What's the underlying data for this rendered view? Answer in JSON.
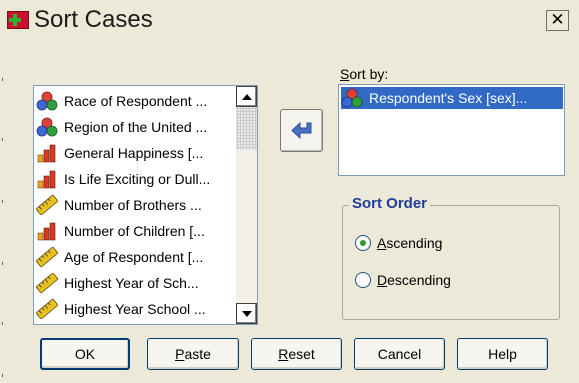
{
  "window": {
    "title": "Sort Cases",
    "close_icon": "close-icon"
  },
  "variable_list": {
    "items": [
      {
        "label": "Race of Respondent ...",
        "icon": "nominal-icon"
      },
      {
        "label": "Region of the United ...",
        "icon": "nominal-icon"
      },
      {
        "label": "General Happiness [...",
        "icon": "ordinal-icon"
      },
      {
        "label": "Is Life Exciting or Dull...",
        "icon": "ordinal-icon"
      },
      {
        "label": "Number of Brothers ...",
        "icon": "scale-icon"
      },
      {
        "label": "Number of Children [...",
        "icon": "ordinal-icon"
      },
      {
        "label": "Age of Respondent [...",
        "icon": "scale-icon"
      },
      {
        "label": "Highest Year of Sch...",
        "icon": "scale-icon"
      },
      {
        "label": "Highest Year School ...",
        "icon": "scale-icon"
      }
    ]
  },
  "sort_by": {
    "label_pre": "",
    "label_key": "S",
    "label_post": "ort by:",
    "items": [
      {
        "label": "Respondent's Sex [sex]...",
        "icon": "nominal-icon"
      }
    ]
  },
  "sort_order": {
    "title": "Sort Order",
    "options": [
      {
        "key": "A",
        "rest": "scending",
        "selected": true
      },
      {
        "key": "D",
        "rest": "escending",
        "selected": false
      }
    ]
  },
  "buttons": {
    "ok": "OK",
    "paste_key": "P",
    "paste_rest": "aste",
    "reset_key": "R",
    "reset_rest": "eset",
    "cancel": "Cancel",
    "help": "Help"
  },
  "colors": {
    "nominal_a": "#e0403a",
    "nominal_b": "#3a68d8",
    "nominal_c": "#2e9e3e",
    "ordinal_red": "#d93b22",
    "ordinal_orange": "#f2a020",
    "scale_yellow": "#e8c020",
    "move_arrow": "#4a6fc4",
    "selection": "#316ac5",
    "group_title": "#1f3d99"
  }
}
